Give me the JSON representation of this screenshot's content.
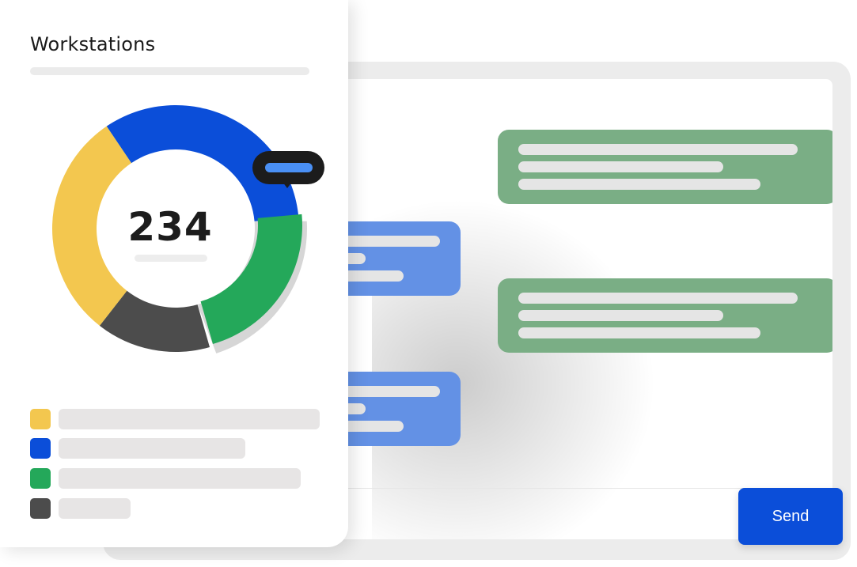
{
  "workstations": {
    "title": "Workstations",
    "total": "234"
  },
  "chart_data": {
    "type": "pie",
    "donut": true,
    "center_label": "234",
    "colors": [
      "#f3c74f",
      "#0b4ed9",
      "#24a85a",
      "#4c4c4c"
    ],
    "values": [
      30,
      33,
      22,
      15
    ]
  },
  "legend": {
    "colors": [
      "#f3c74f",
      "#0b4ed9",
      "#24a85a",
      "#4c4c4c"
    ]
  },
  "chat": {
    "send_label": "Send",
    "outgoing_color": "#7aae85",
    "incoming_color": "#6391e5",
    "accent_color": "#0b4ed9"
  }
}
